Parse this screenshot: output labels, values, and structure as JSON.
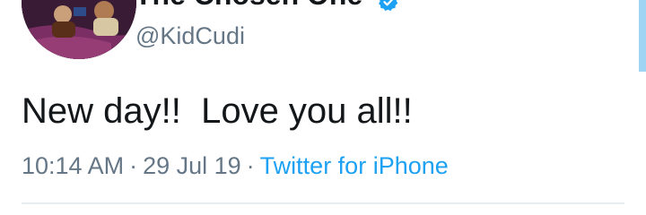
{
  "user": {
    "display_name": "The Chosen One",
    "handle": "@KidCudi",
    "verified_icon": "verified-badge-icon",
    "avatar_icon": "avatar-photo"
  },
  "tweet": {
    "text": "New day!!  Love you all!!",
    "time": "10:14 AM",
    "date": "29 Jul 19",
    "source": "Twitter for iPhone",
    "separator": "·"
  },
  "colors": {
    "text_primary": "#14171a",
    "text_secondary": "#657786",
    "link": "#1da1f2",
    "divider": "#e6ecf0"
  }
}
